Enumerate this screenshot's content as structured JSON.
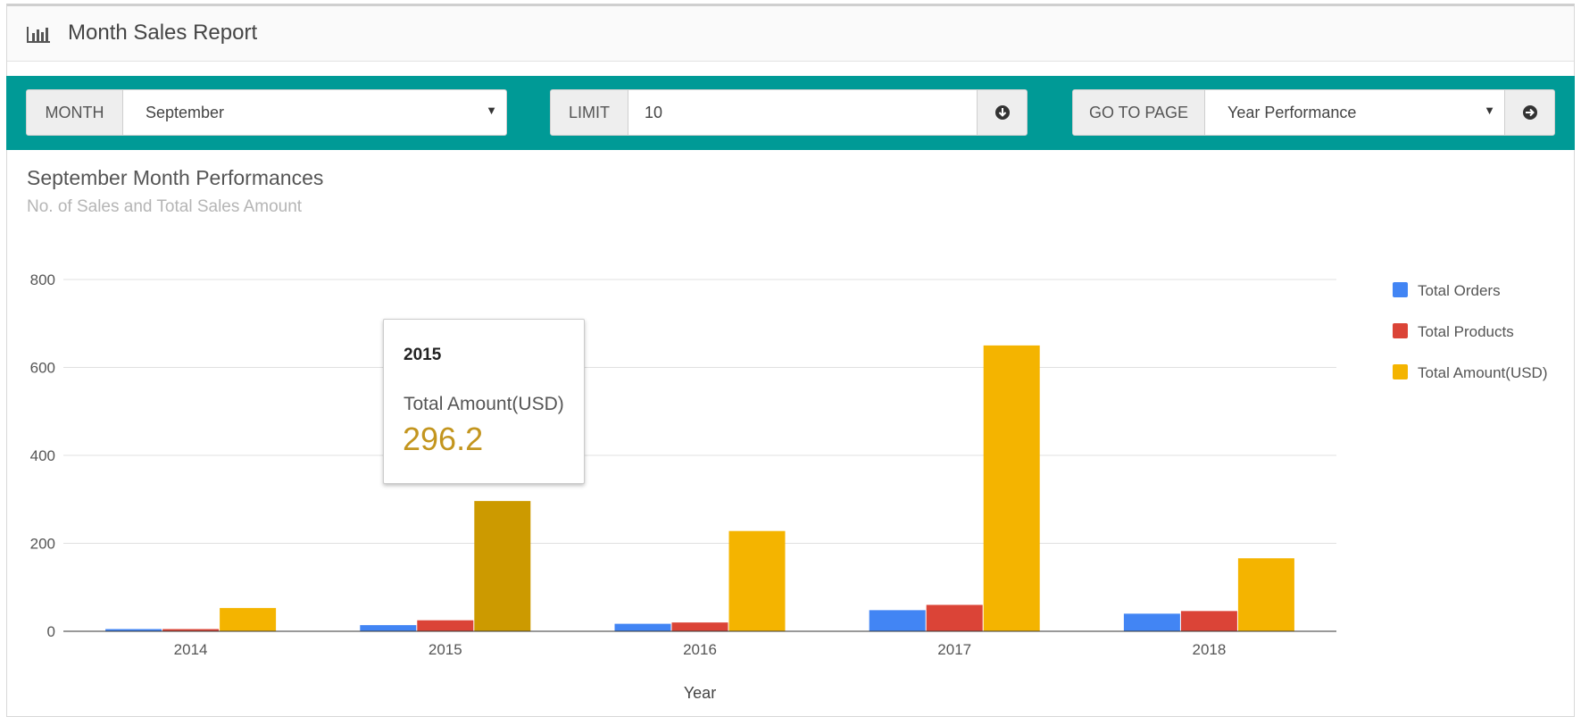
{
  "header": {
    "title": "Month Sales Report",
    "icon": "bar-chart-icon"
  },
  "filters": {
    "month": {
      "label": "MONTH",
      "value": "September"
    },
    "limit": {
      "label": "LIMIT",
      "value": "10",
      "button_icon": "circle-arrow-down-icon"
    },
    "goto": {
      "label": "GO TO PAGE",
      "value": "Year Performance",
      "button_icon": "circle-arrow-right-icon"
    }
  },
  "colors": {
    "bar": "#009a96",
    "orders": "#4285f4",
    "products": "#db4437",
    "amount": "#f4b400",
    "amount_highlight": "#cc9a00"
  },
  "tooltip": {
    "year": "2015",
    "label": "Total Amount(USD)",
    "value": "296.2"
  },
  "chart_data": {
    "type": "bar",
    "title": "September Month Performances",
    "subtitle": "No. of Sales and Total Sales Amount",
    "xlabel": "Year",
    "ylabel": "",
    "categories": [
      "2014",
      "2015",
      "2016",
      "2017",
      "2018"
    ],
    "series": [
      {
        "name": "Total Orders",
        "values": [
          5,
          14,
          17,
          48,
          40
        ]
      },
      {
        "name": "Total Products",
        "values": [
          5,
          25,
          20,
          60,
          46
        ]
      },
      {
        "name": "Total Amount(USD)",
        "values": [
          53,
          296.2,
          228,
          650,
          166
        ]
      }
    ],
    "ylim": [
      0,
      800
    ],
    "yticks": [
      0,
      200,
      400,
      600,
      800
    ],
    "grid": true,
    "legend": "right",
    "highlight": {
      "series": 2,
      "category": 1
    }
  }
}
